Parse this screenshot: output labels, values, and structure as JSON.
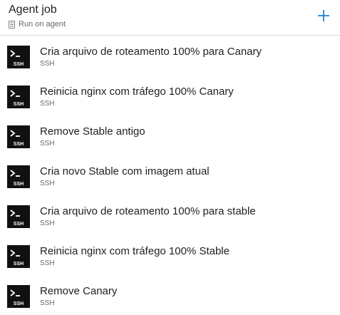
{
  "job": {
    "title": "Agent job",
    "subtitle": "Run on agent",
    "add_icon": "plus-icon",
    "agent_icon": "agent-icon"
  },
  "tasks": [
    {
      "name": "Cria arquivo de roteamento 100% para Canary",
      "type": "SSH",
      "icon": "ssh-terminal-icon"
    },
    {
      "name": "Reinicia nginx com tráfego 100% Canary",
      "type": "SSH",
      "icon": "ssh-terminal-icon"
    },
    {
      "name": "Remove Stable antigo",
      "type": "SSH",
      "icon": "ssh-terminal-icon"
    },
    {
      "name": "Cria novo Stable com imagem atual",
      "type": "SSH",
      "icon": "ssh-terminal-icon"
    },
    {
      "name": "Cria arquivo de roteamento 100% para stable",
      "type": "SSH",
      "icon": "ssh-terminal-icon"
    },
    {
      "name": "Reinicia nginx com tráfego 100% Stable",
      "type": "SSH",
      "icon": "ssh-terminal-icon"
    },
    {
      "name": "Remove Canary",
      "type": "SSH",
      "icon": "ssh-terminal-icon"
    }
  ],
  "colors": {
    "accent": "#0078d4",
    "icon_bg": "#111111",
    "text": "#201f1e",
    "muted": "#666666"
  }
}
